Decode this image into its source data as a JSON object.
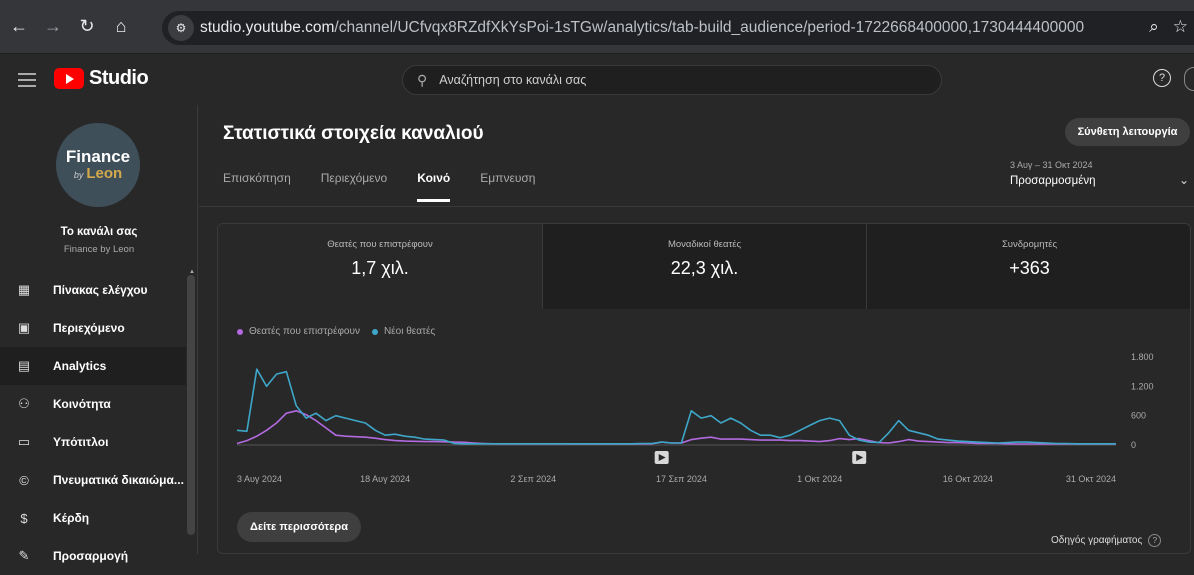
{
  "browser": {
    "url_host": "studio.youtube.com",
    "url_path": "/channel/UCfvqx8RZdfXkYsPoi-1sTGw/analytics/tab-build_audience/period-1722668400000,1730444400000"
  },
  "header": {
    "logo_text": "Studio",
    "search_placeholder": "Αναζήτηση στο κανάλι σας"
  },
  "sidebar": {
    "avatar_line1": "Finance",
    "avatar_by": "by",
    "avatar_line2": "Leon",
    "channel_title": "Το κανάλι σας",
    "channel_name": "Finance by Leon",
    "items": [
      {
        "label": "Πίνακας ελέγχου",
        "icon": "dashboard-icon"
      },
      {
        "label": "Περιεχόμενο",
        "icon": "content-icon"
      },
      {
        "label": "Analytics",
        "icon": "analytics-icon"
      },
      {
        "label": "Κοινότητα",
        "icon": "community-icon"
      },
      {
        "label": "Υπότιτλοι",
        "icon": "subtitles-icon"
      },
      {
        "label": "Πνευματικά δικαιώμα...",
        "icon": "copyright-icon"
      },
      {
        "label": "Κέρδη",
        "icon": "earn-icon"
      },
      {
        "label": "Προσαρμογή",
        "icon": "customization-icon"
      }
    ]
  },
  "main": {
    "title": "Στατιστικά στοιχεία καναλιού",
    "advanced_button": "Σύνθετη λειτουργία",
    "tabs": [
      "Επισκόπηση",
      "Περιεχόμενο",
      "Κοινό",
      "Εμπνευση"
    ],
    "active_tab": 2,
    "period_range": "3 Αυγ – 31 Οκτ 2024",
    "period_label": "Προσαρμοσμένη",
    "metrics": [
      {
        "label": "Θεατές που επιστρέφουν",
        "value": "1,7 χιλ."
      },
      {
        "label": "Μοναδικοί θεατές",
        "value": "22,3 χιλ."
      },
      {
        "label": "Συνδρομητές",
        "value": "+363"
      }
    ],
    "see_more": "Δείτε περισσότερα",
    "chart_guide": "Οδηγός γραφήματος"
  },
  "chart_data": {
    "type": "line",
    "ylim": [
      0,
      1800
    ],
    "yticks": [
      "1.800",
      "1.200",
      "600",
      "0"
    ],
    "ytick_values": [
      1800,
      1200,
      600,
      0
    ],
    "x_tick_labels": [
      "3 Αυγ 2024",
      "18 Αυγ 2024",
      "2 Σεπ 2024",
      "17 Σεπ 2024",
      "1 Οκτ 2024",
      "16 Οκτ 2024",
      "31 Οκτ 2024"
    ],
    "x_tick_days": [
      0,
      15,
      30,
      45,
      59,
      74,
      89
    ],
    "x_days": 89,
    "video_markers_days": [
      43,
      63
    ],
    "series": [
      {
        "name": "Θεατές που επιστρέφουν",
        "color": "#b36ae0",
        "values": [
          30,
          90,
          180,
          300,
          450,
          650,
          700,
          620,
          500,
          350,
          200,
          180,
          170,
          160,
          140,
          110,
          90,
          80,
          75,
          70,
          70,
          65,
          60,
          55,
          40,
          30,
          25,
          25,
          25,
          25,
          25,
          25,
          25,
          25,
          20,
          20,
          20,
          20,
          20,
          20,
          20,
          25,
          25,
          60,
          40,
          40,
          110,
          140,
          160,
          120,
          120,
          120,
          110,
          100,
          100,
          100,
          90,
          90,
          80,
          70,
          90,
          130,
          110,
          130,
          90,
          50,
          40,
          70,
          110,
          80,
          70,
          60,
          50,
          50,
          40,
          30,
          30,
          30,
          25,
          20,
          20,
          20,
          20,
          20,
          20,
          20,
          20,
          20,
          20,
          20
        ]
      },
      {
        "name": "Νέοι θεατές",
        "color": "#3ea6c8",
        "values": [
          300,
          280,
          1550,
          1200,
          1450,
          1500,
          800,
          550,
          650,
          500,
          600,
          550,
          500,
          450,
          300,
          200,
          220,
          180,
          160,
          120,
          110,
          100,
          30,
          25,
          25,
          25,
          25,
          25,
          25,
          25,
          25,
          25,
          25,
          25,
          25,
          25,
          25,
          25,
          25,
          25,
          25,
          30,
          30,
          60,
          40,
          40,
          700,
          550,
          600,
          450,
          550,
          450,
          300,
          200,
          200,
          150,
          200,
          300,
          400,
          500,
          550,
          500,
          200,
          100,
          60,
          50,
          250,
          500,
          300,
          250,
          200,
          120,
          100,
          80,
          70,
          60,
          50,
          40,
          50,
          60,
          60,
          50,
          40,
          30,
          30,
          25,
          25,
          25,
          25,
          25
        ]
      }
    ]
  }
}
